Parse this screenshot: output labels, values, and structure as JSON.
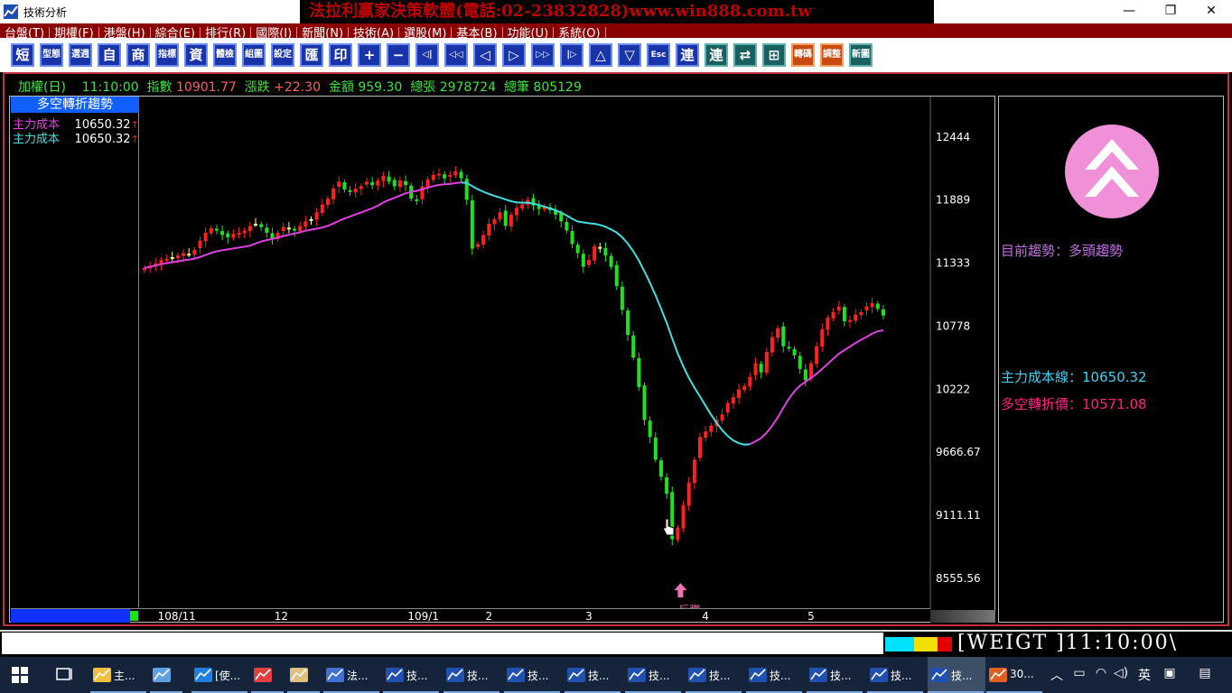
{
  "window": {
    "title": "技術分析",
    "banner": "法拉利贏家決策軟體(電話:02-23832828)www.win888.com.tw",
    "minimize": "—",
    "restore": "❐",
    "close": "✕"
  },
  "menu": [
    "台盤(T)",
    "期權(F)",
    "港盤(H)",
    "綜合(E)",
    "排行(R)",
    "國際(I)",
    "新聞(N)",
    "技術(A)",
    "選股(M)",
    "基本(B)",
    "功能(U)",
    "系統(O)"
  ],
  "toolbar": [
    "短",
    "型態",
    "選週",
    "自",
    "商",
    "指標",
    "資",
    "體檢",
    "組圖",
    "設定",
    "匯",
    "印",
    "+",
    "−",
    "◁|",
    "◁◁",
    "◁",
    "▷",
    "▷▷",
    "|▷",
    "△",
    "▽",
    "Esc",
    "連",
    "連",
    "⇄",
    "⊞",
    "轉碼",
    "調整",
    "新圖"
  ],
  "info": {
    "name": "加權(日)",
    "time": "11:10:00",
    "index_label": "指數",
    "index_value": "10901.77",
    "change_label": "漲跌",
    "change_value": "+22.30",
    "amount_label": "金額",
    "amount_value": "959.30",
    "volume_label": "總張",
    "volume_value": "2978724",
    "trades_label": "總筆",
    "trades_value": "805129"
  },
  "legend": {
    "title": "多空轉折趨勢",
    "rows": [
      {
        "label": "主力成本",
        "value": "10650.32",
        "mark": "↑",
        "color": "#e040e0"
      },
      {
        "label": "主力成本",
        "value": "10650.32",
        "mark": "↑",
        "color": "#40e0e0"
      }
    ]
  },
  "side": {
    "trend_label": "目前趨勢：",
    "trend_value": "多頭趨勢",
    "cost_label": "主力成本線：",
    "cost_value": "10650.32",
    "turn_label": "多空轉折價：",
    "turn_value": "10571.08"
  },
  "status": {
    "text": "[WEIGT ]11:10:00\\",
    "blocks": [
      "#00e0ff",
      "#00e0ff",
      "#f0e000",
      "#e00000"
    ]
  },
  "taskbar": {
    "items": [
      {
        "icon": "folder-icon",
        "label": "主..."
      },
      {
        "icon": "computer-icon",
        "label": ""
      },
      {
        "icon": "ie-icon",
        "label": "[使..."
      },
      {
        "icon": "chrome-icon",
        "label": ""
      },
      {
        "icon": "paint-icon",
        "label": ""
      },
      {
        "icon": "app-icon",
        "label": "法..."
      },
      {
        "icon": "chart-app-icon",
        "label": "技..."
      },
      {
        "icon": "chart-app-icon",
        "label": "技..."
      },
      {
        "icon": "chart-app-icon",
        "label": "技..."
      },
      {
        "icon": "chart-app-icon",
        "label": "技..."
      },
      {
        "icon": "chart-app-icon",
        "label": "技..."
      },
      {
        "icon": "chart-app-icon",
        "label": "技..."
      },
      {
        "icon": "chart-app-icon",
        "label": "技..."
      },
      {
        "icon": "chart-app-icon",
        "label": "技..."
      },
      {
        "icon": "chart-app-icon",
        "label": "技..."
      },
      {
        "icon": "chart-app-icon",
        "label": "技..."
      },
      {
        "icon": "office-icon",
        "label": "30..."
      }
    ],
    "ime": "英"
  },
  "chart_data": {
    "type": "candlestick",
    "title": "加權(日)",
    "y_ticks": [
      "12444",
      "11889",
      "11333",
      "10778",
      "10222",
      "9666.67",
      "9111.11",
      "8555.56"
    ],
    "ylim": [
      8300,
      12800
    ],
    "x_ticks": [
      {
        "label": "108/11",
        "index": 4
      },
      {
        "label": "12",
        "index": 25
      },
      {
        "label": "109/1",
        "index": 49
      },
      {
        "label": "2",
        "index": 63
      },
      {
        "label": "3",
        "index": 81
      },
      {
        "label": "4",
        "index": 102
      },
      {
        "label": "5",
        "index": 121
      }
    ],
    "annotation": {
      "label": "反彈",
      "index": 96
    },
    "closes": [
      11290,
      11310,
      11330,
      11360,
      11370,
      11380,
      11400,
      11420,
      11410,
      11450,
      11530,
      11600,
      11640,
      11620,
      11580,
      11560,
      11590,
      11600,
      11620,
      11660,
      11680,
      11650,
      11600,
      11550,
      11600,
      11650,
      11640,
      11620,
      11660,
      11700,
      11720,
      11780,
      11850,
      11900,
      11990,
      12050,
      11980,
      11960,
      11990,
      12010,
      12050,
      12020,
      12060,
      12100,
      12050,
      12010,
      12060,
      12020,
      11900,
      11880,
      12010,
      12070,
      12110,
      12120,
      12080,
      12110,
      12140,
      12080,
      11890,
      11460,
      11500,
      11580,
      11680,
      11720,
      11780,
      11660,
      11760,
      11820,
      11850,
      11890,
      11840,
      11810,
      11830,
      11800,
      11760,
      11700,
      11620,
      11500,
      11420,
      11300,
      11360,
      11480,
      11470,
      11400,
      11300,
      11130,
      10920,
      10700,
      10500,
      10240,
      9950,
      9800,
      9600,
      9450,
      9300,
      8900,
      9000,
      9200,
      9400,
      9600,
      9800,
      9850,
      9900,
      9950,
      10000,
      10100,
      10150,
      10220,
      10250,
      10330,
      10450,
      10370,
      10550,
      10680,
      10760,
      10600,
      10580,
      10520,
      10400,
      10300,
      10450,
      10600,
      10750,
      10850,
      10900,
      10950,
      10820,
      10830,
      10880,
      10900,
      10950,
      10980,
      10930,
      10870
    ],
    "colors": {
      "up": "#ff2020",
      "down": "#20e020",
      "flat": "#ffff80",
      "ma_bull": "#e040e0",
      "ma_bear": "#40e0e0"
    }
  }
}
